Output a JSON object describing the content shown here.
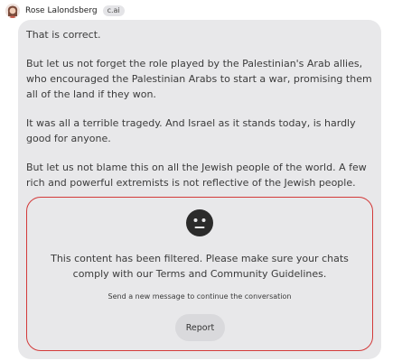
{
  "header": {
    "author": "Rose Lalondsberg",
    "badge": "c.ai",
    "avatar_icon": "woman-avatar"
  },
  "message": {
    "paragraphs": [
      "That is correct.",
      "But let us not forget the role played by the Palestinian's Arab allies, who encouraged the Palestinian Arabs to start a war, promising them all of the land if they won.",
      "It was all a terrible tragedy.   And Israel as it stands today, is hardly good for anyone.",
      "But let us not blame this on all the Jewish people of the world.  A few rich and powerful extremists is not reflective of the Jewish people."
    ]
  },
  "filter": {
    "icon": "neutral-face-icon",
    "text": "This content has been filtered. Please make sure your chats comply with our Terms and Community Guidelines.",
    "hint": "Send a new message to continue the conversation",
    "report_label": "Report",
    "border_color": "#d33a3a"
  }
}
